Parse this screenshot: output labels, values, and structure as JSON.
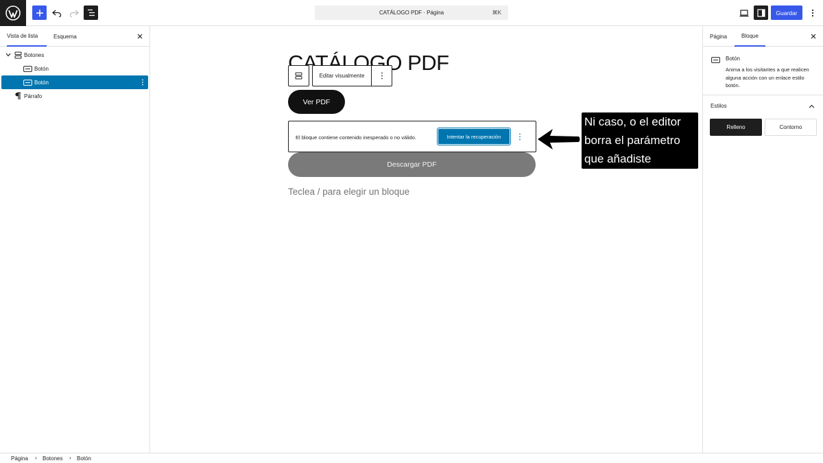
{
  "topbar": {
    "command_title": "CATÁLOGO PDF · Página",
    "command_shortcut": "⌘K",
    "save_label": "Guardar"
  },
  "left_panel": {
    "tabs": [
      {
        "label": "Vista de lista",
        "active": true
      },
      {
        "label": "Esquema",
        "active": false
      }
    ],
    "tree": [
      {
        "label": "Botones",
        "icon": "buttons-icon",
        "level": 0,
        "expanded": true,
        "selected": false
      },
      {
        "label": "Botón",
        "icon": "button-icon",
        "level": 1,
        "selected": false
      },
      {
        "label": "Botón",
        "icon": "button-icon",
        "level": 1,
        "selected": true
      },
      {
        "label": "Párrafo",
        "icon": "paragraph-icon",
        "level": 0,
        "selected": false
      }
    ]
  },
  "canvas": {
    "page_title": "CATÁLOGO PDF",
    "toolbar_edit_label": "Editar visualmente",
    "ver_pdf_label": "Ver PDF",
    "warning_text": "El bloque contiene contenido inesperado o no válido.",
    "recovery_label": "Intentar la recuperación",
    "descargar_label": "Descargar PDF",
    "appender_text": "Teclea / para elegir un bloque"
  },
  "annotation": {
    "lines": [
      "Ni caso, o el editor",
      "borra el parámetro",
      "que añadiste"
    ]
  },
  "right_panel": {
    "tabs": [
      {
        "label": "Página",
        "active": false
      },
      {
        "label": "Bloque",
        "active": true
      }
    ],
    "block_title": "Botón",
    "block_description": "Anima a los visitantes a que realicen alguna acción con un enlace estilo botón.",
    "styles_title": "Estilos",
    "style_fill": "Relleno",
    "style_outline": "Contorno"
  },
  "breadcrumb": [
    "Página",
    "Botones",
    "Botón"
  ],
  "colors": {
    "accent": "#3858e9",
    "selected": "#0075af",
    "dark": "#1e1e1e"
  }
}
